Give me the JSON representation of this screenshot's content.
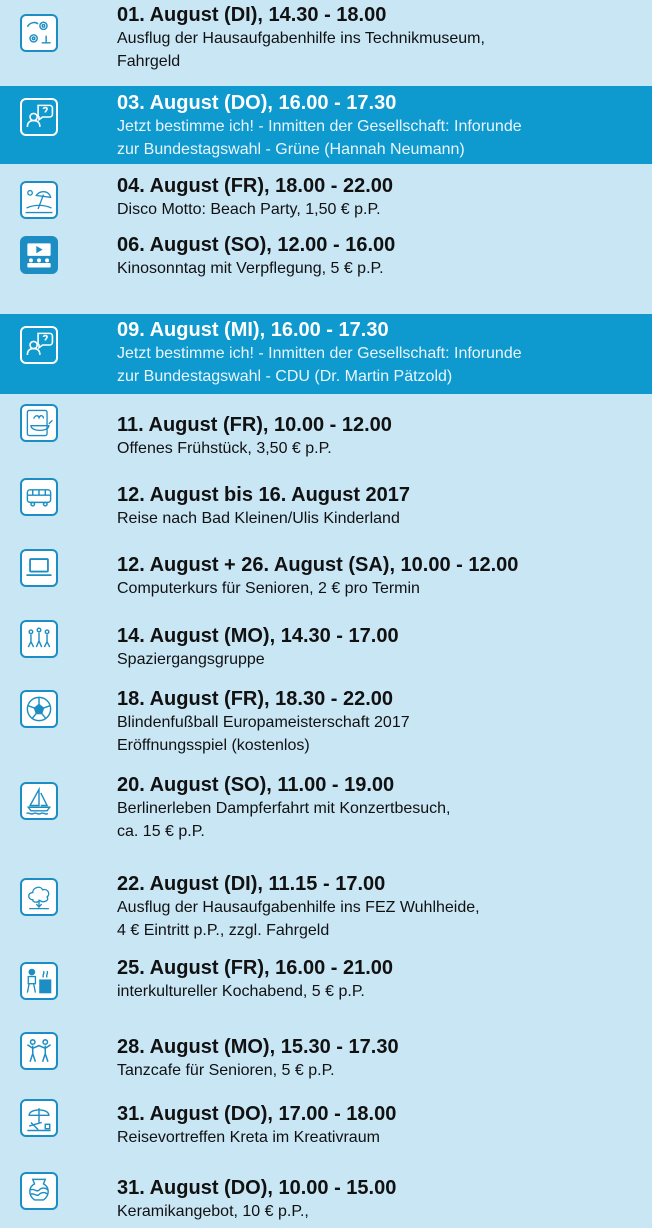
{
  "colors": {
    "background": "#c9e6f5",
    "highlight": "#0e99cf",
    "accent": "#1d8ec4"
  },
  "events": [
    {
      "title": "01. August (DI), 14.30 - 18.00",
      "desc": [
        "Ausflug der Hausaufgabenhilfe ins Technikmuseum,",
        "Fahrgeld"
      ],
      "icon": "gears-person-icon",
      "highlight": false
    },
    {
      "title": "03. August (DO), 16.00 - 17.30",
      "desc": [
        "Jetzt bestimme ich! - Inmitten der Gesellschaft: Inforunde",
        "zur Bundestagswahl - Grüne (Hannah Neumann)"
      ],
      "icon": "question-person-icon",
      "highlight": true
    },
    {
      "title": "04. August (FR), 18.00 - 22.00",
      "desc": [
        "Disco Motto: Beach Party, 1,50 € p.P."
      ],
      "icon": "beach-umbrella-icon",
      "highlight": false
    },
    {
      "title": "06. August (SO), 12.00 - 16.00",
      "desc": [
        "Kinosonntag mit Verpflegung, 5 € p.P."
      ],
      "icon": "cinema-icon",
      "highlight": false
    },
    {
      "title": "09. August (MI), 16.00 - 17.30",
      "desc": [
        "Jetzt bestimme ich! - Inmitten der Gesellschaft: Inforunde",
        "zur Bundestagswahl - CDU (Dr. Martin Pätzold)"
      ],
      "icon": "question-person-icon",
      "highlight": true
    },
    {
      "title": "11. August (FR), 10.00 - 12.00",
      "desc": [
        "Offenes Frühstück, 3,50 € p.P."
      ],
      "icon": "breakfast-icon",
      "highlight": false
    },
    {
      "title": "12. August bis 16. August 2017",
      "desc": [
        "Reise nach Bad Kleinen/Ulis Kinderland"
      ],
      "icon": "bus-icon",
      "highlight": false
    },
    {
      "title": "12. August + 26. August (SA), 10.00 - 12.00",
      "desc": [
        "Computerkurs für Senioren, 2 € pro Termin"
      ],
      "icon": "laptop-icon",
      "highlight": false
    },
    {
      "title": "14. August (MO), 14.30 - 17.00",
      "desc": [
        "Spaziergangsgruppe"
      ],
      "icon": "walking-group-icon",
      "highlight": false
    },
    {
      "title": "18. August (FR), 18.30 - 22.00",
      "desc": [
        "Blindenfußball Europameisterschaft 2017",
        "Eröffnungsspiel (kostenlos)"
      ],
      "icon": "soccer-ball-icon",
      "highlight": false
    },
    {
      "title": "20. August (SO), 11.00 - 19.00",
      "desc": [
        "Berlinerleben Dampferfahrt mit Konzertbesuch,",
        "ca. 15 € p.P."
      ],
      "icon": "sailboat-icon",
      "highlight": false
    },
    {
      "title": "22. August (DI), 11.15 - 17.00",
      "desc": [
        "Ausflug der Hausaufgabenhilfe ins FEZ Wuhlheide,",
        "4 € Eintritt p.P., zzgl. Fahrgeld"
      ],
      "icon": "tree-icon",
      "highlight": false
    },
    {
      "title": "25. August (FR), 16.00 - 21.00",
      "desc": [
        "interkultureller Kochabend, 5 € p.P."
      ],
      "icon": "cooking-icon",
      "highlight": false
    },
    {
      "title": "28. August (MO), 15.30 - 17.30",
      "desc": [
        "Tanzcafe für Senioren, 5 € p.P."
      ],
      "icon": "dancing-icon",
      "highlight": false
    },
    {
      "title": "31. August (DO), 17.00 - 18.00",
      "desc": [
        "Reisevortreffen Kreta im Kreativraum"
      ],
      "icon": "beach-chair-icon",
      "highlight": false
    },
    {
      "title": "31. August (DO), 10.00 - 15.00",
      "desc": [
        "Keramikangebot, 10 € p.P.,"
      ],
      "icon": "pottery-icon",
      "highlight": false
    }
  ]
}
